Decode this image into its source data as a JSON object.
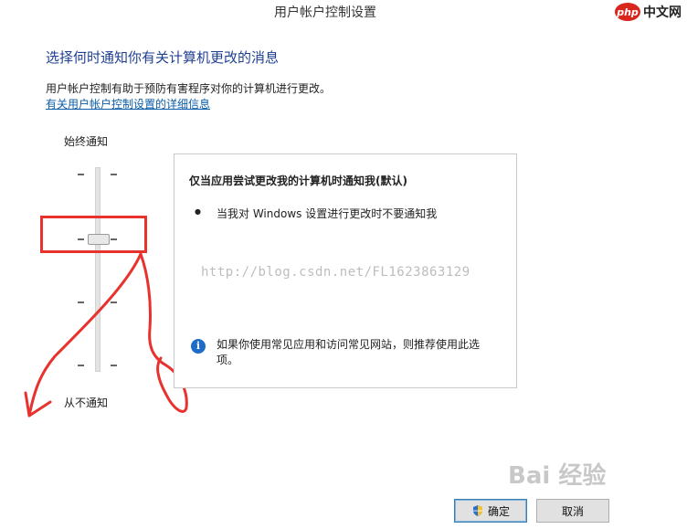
{
  "window": {
    "title": "用户帐户控制设置",
    "logo_badge": "php",
    "logo_text": "中文网"
  },
  "main": {
    "heading": "选择何时通知你有关计算机更改的消息",
    "description": "用户帐户控制有助于预防有害程序对你的计算机进行更改。",
    "link": "有关用户帐户控制设置的详细信息"
  },
  "slider": {
    "top_label": "始终通知",
    "bottom_label": "从不通知",
    "levels": 4,
    "selected_level": 2
  },
  "panel": {
    "title": "仅当应用尝试更改我的计算机时通知我(默认)",
    "bullet": "当我对 Windows 设置进行更改时不要通知我",
    "info_icon": "i",
    "info_text": "如果你使用常见应用和访问常见网站，则推荐使用此选项。"
  },
  "watermark": "http://blog.csdn.net/FL1623863129",
  "baidu_watermark": "Bai 经验",
  "buttons": {
    "ok": "确定",
    "cancel": "取消"
  },
  "colors": {
    "heading": "#1f3f91",
    "link": "#0b5ca8",
    "annotation": "#e8322e"
  }
}
